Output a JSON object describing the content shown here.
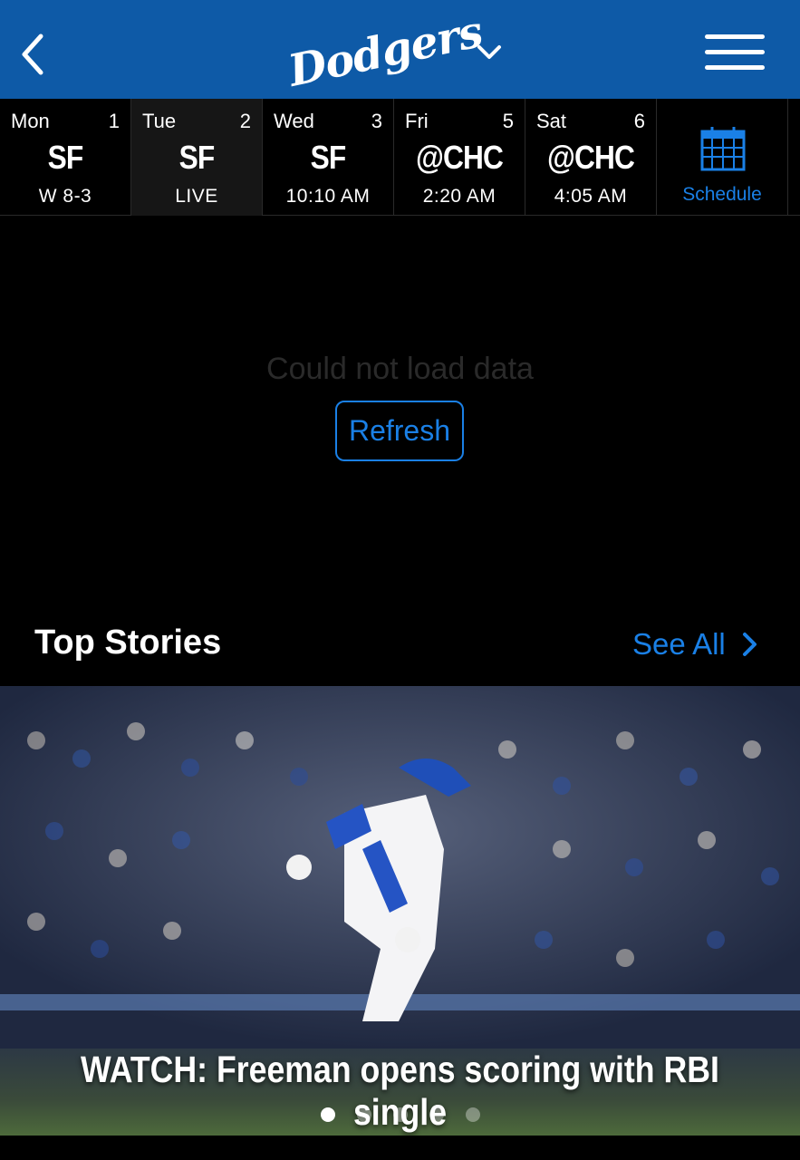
{
  "header": {
    "logo_text": "Dodgers",
    "back_icon": "chevron-left-icon",
    "team_switch_icon": "chevron-down-icon",
    "menu_icon": "hamburger-menu-icon",
    "bg_color": "#0E5AA7"
  },
  "schedule_strip": {
    "days": [
      {
        "day": "Mon",
        "date": "1",
        "opponent": "SF",
        "status": "W 8-3"
      },
      {
        "day": "Tue",
        "date": "2",
        "opponent": "SF",
        "status": "LIVE"
      },
      {
        "day": "Wed",
        "date": "3",
        "opponent": "SF",
        "status": "10:10 AM"
      },
      {
        "day": "Fri",
        "date": "5",
        "opponent": "@CHC",
        "status": "2:20 AM"
      },
      {
        "day": "Sat",
        "date": "6",
        "opponent": "@CHC",
        "status": "4:05 AM"
      }
    ],
    "schedule_label": "Schedule",
    "schedule_icon": "calendar-icon"
  },
  "error": {
    "message": "Could not load data",
    "refresh_label": "Refresh"
  },
  "top_stories": {
    "title": "Top Stories",
    "see_all_label": "See All",
    "see_all_icon": "chevron-right-icon",
    "featured_headline": "WATCH: Freeman opens scoring with RBI single",
    "carousel_total": 5,
    "carousel_active": 1
  },
  "colors": {
    "accent_blue": "#1a80e6",
    "header_blue": "#0E5AA7"
  }
}
